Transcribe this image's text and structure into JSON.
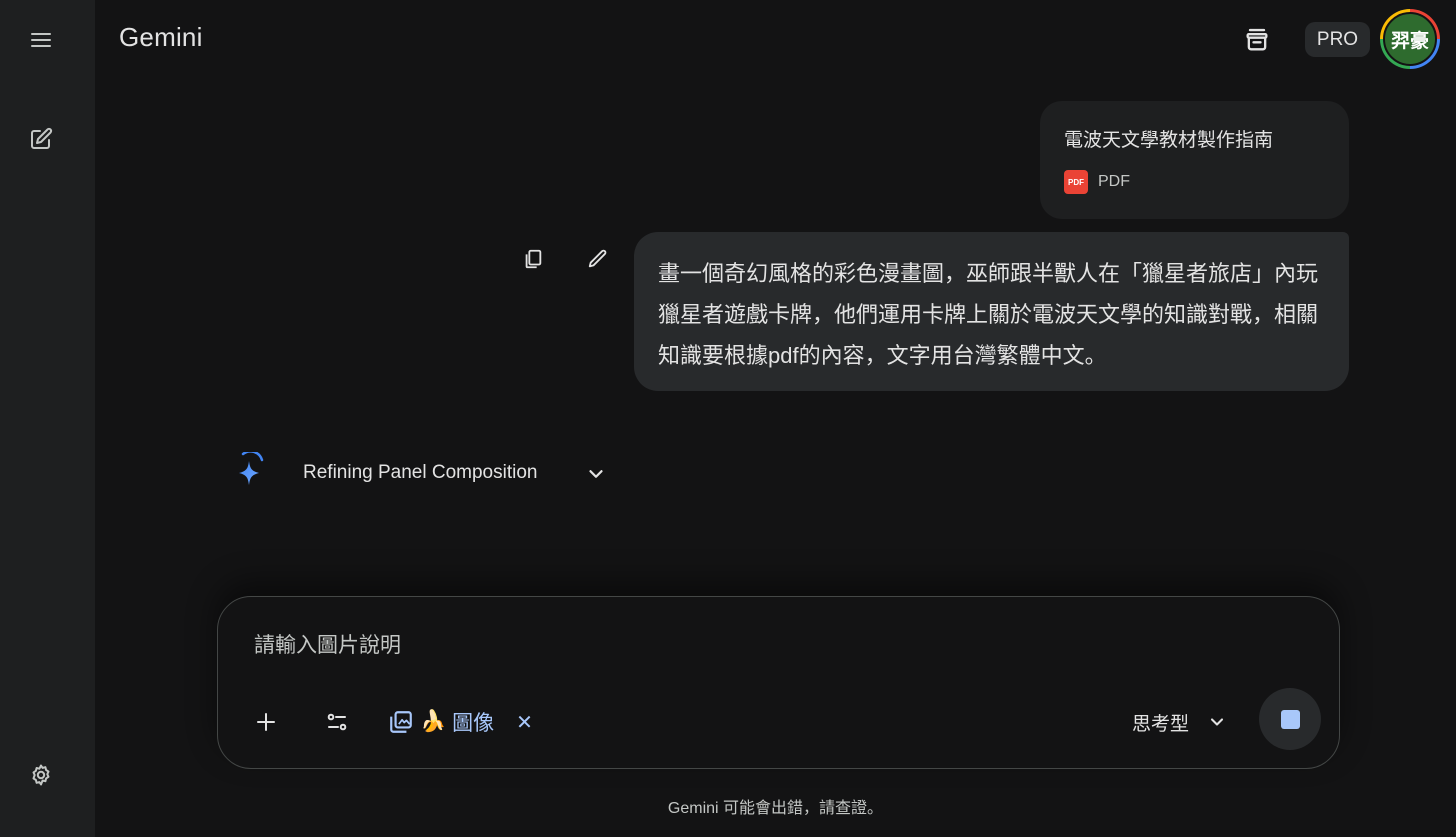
{
  "header": {
    "brand": "Gemini",
    "pro_label": "PRO",
    "avatar_text": "羿豪"
  },
  "rail": {
    "menu_icon": "menu-icon",
    "new_chat_icon": "edit-square-icon",
    "settings_icon": "gear-icon"
  },
  "conversation": {
    "attachment": {
      "title": "電波天文學教材製作指南",
      "type_label": "PDF",
      "badge_text": "PDF"
    },
    "user_prompt": "畫一個奇幻風格的彩色漫畫圖，巫師跟半獸人在「獵星者旅店」內玩獵星者遊戲卡牌，他們運用卡牌上關於電波天文學的知識對戰，相關知識要根據pdf的內容，文字用台灣繁體中文。",
    "thinking_label": "Refining Panel Composition"
  },
  "composer": {
    "placeholder": "請輸入圖片說明",
    "value": "",
    "tool_chip_label": "圖像",
    "tool_chip_emoji": "🍌",
    "mode_label": "思考型"
  },
  "footer": {
    "disclaimer": "Gemini 可能會出錯，請查證。"
  },
  "colors": {
    "background": "#131314",
    "rail": "#1e1f20",
    "accent": "#a8c7fa",
    "avatar_bg": "#2e6b2e"
  }
}
